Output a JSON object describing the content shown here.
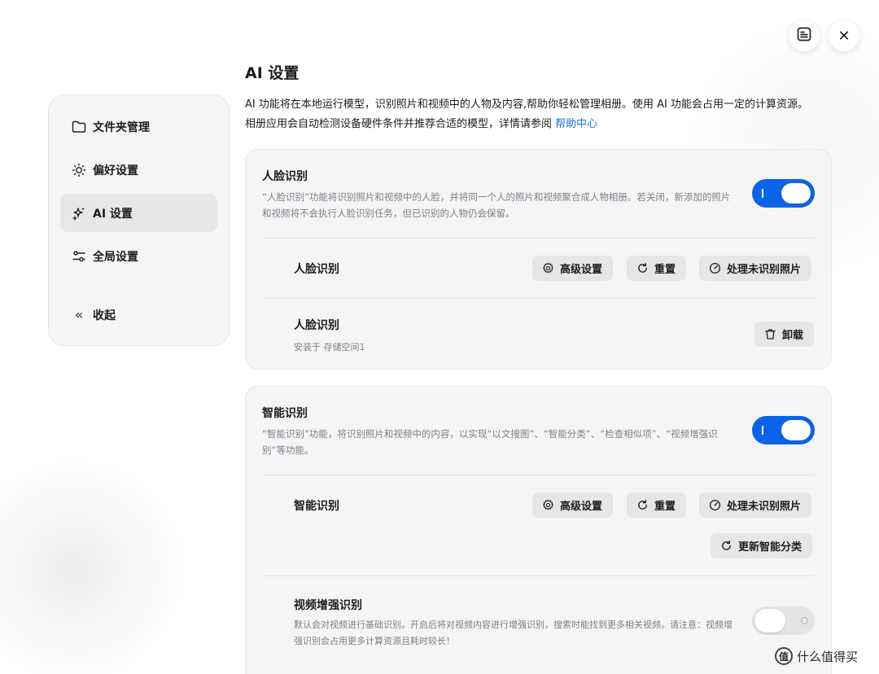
{
  "window": {
    "doc_icon": "document-list-icon",
    "close_icon": "close-icon",
    "close_glyph": "✕"
  },
  "sidebar": {
    "items": [
      {
        "label": "文件夹管理",
        "icon": "folder-icon"
      },
      {
        "label": "偏好设置",
        "icon": "sun-icon"
      },
      {
        "label": "AI 设置",
        "icon": "sparkle-icon",
        "active": true
      },
      {
        "label": "全局设置",
        "icon": "sliders-icon"
      }
    ],
    "collapse": {
      "label": "收起",
      "icon": "chevron-double-left-icon",
      "glyph": "«"
    }
  },
  "main": {
    "title": "AI 设置",
    "intro_line1": "AI 功能将在本地运行模型，识别照片和视频中的人物及内容,帮助你轻松管理相册。使用 AI 功能会占用一定的计算资源。",
    "intro_line2": "相册应用会自动检测设备硬件条件并推荐合适的模型，详情请参阅",
    "help_link": "帮助中心"
  },
  "face_card": {
    "title": "人脸识别",
    "desc": "“人脸识别”功能将识别照片和视频中的人脸，并将同一个人的照片和视频聚合成人物相册。若关闭，新添加的照片和视频将不会执行人脸识别任务，但已识别的人物仍会保留。",
    "enabled": true,
    "row1": {
      "title": "人脸识别",
      "advanced": "高级设置",
      "reset": "重置",
      "process": "处理未识别照片"
    },
    "row2": {
      "title": "人脸识别",
      "installed": "安装于 存储空间1",
      "uninstall": "卸载"
    }
  },
  "smart_card": {
    "title": "智能识别",
    "desc": "“智能识别”功能，将识别照片和视频中的内容，以实现“以文搜图”、“智能分类”、“检查相似项”、“视频增强识别”等功能。",
    "enabled": true,
    "row1": {
      "title": "智能识别",
      "advanced": "高级设置",
      "reset": "重置",
      "process": "处理未识别照片",
      "update": "更新智能分类"
    },
    "video": {
      "title": "视频增强识别",
      "desc": "默认会对视频进行基础识别。开启后将对视频内容进行增强识别，搜索时能找到更多相关视频。请注意：视频增强识别会占用更多计算资源且耗时较长！",
      "enabled": false
    }
  },
  "watermark": {
    "glyph": "值",
    "text": "什么值得买"
  },
  "colors": {
    "accent": "#0a63e8",
    "link": "#1a73e8",
    "card_bg": "#f5f5f7",
    "button_bg": "#e6e6e9"
  }
}
